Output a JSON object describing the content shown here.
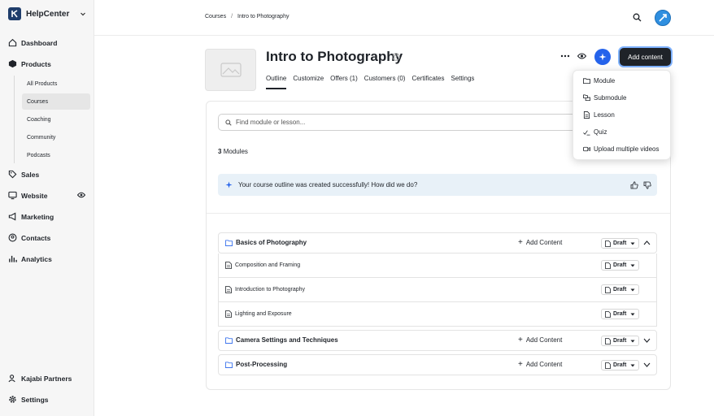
{
  "colors": {
    "brand": "#1f3d6b",
    "accent_blue": "#2563eb",
    "dark_button": "#1f2329",
    "banner_bg": "#e8f1f8"
  },
  "sidebar": {
    "brand": "HelpCenter",
    "items": {
      "dashboard": "Dashboard",
      "products": "Products",
      "sales": "Sales",
      "website": "Website",
      "marketing": "Marketing",
      "contacts": "Contacts",
      "analytics": "Analytics",
      "partners": "Kajabi Partners",
      "settings": "Settings"
    },
    "products_sub": {
      "all_products": "All Products",
      "courses": "Courses",
      "coaching": "Coaching",
      "community": "Community",
      "podcasts": "Podcasts"
    }
  },
  "breadcrumb": {
    "parent": "Courses",
    "separator": "/",
    "current": "Intro to Photography"
  },
  "header": {
    "title": "Intro to Photography",
    "add_button": "Add content",
    "tabs": {
      "outline": "Outline",
      "customize": "Customize",
      "offers": "Offers (1)",
      "customers": "Customers (0)",
      "certificates": "Certificates",
      "settings": "Settings"
    }
  },
  "menu": {
    "module": "Module",
    "submodule": "Submodule",
    "lesson": "Lesson",
    "quiz": "Quiz",
    "upload": "Upload multiple videos"
  },
  "outline": {
    "search_placeholder": "Find module or lesson...",
    "count": "3",
    "count_label": "Modules",
    "banner": "Your course outline was created successfully! How did we do?",
    "add_content": "Add Content",
    "draft": "Draft",
    "modules": {
      "m1": "Basics of Photography",
      "m2": "Camera Settings and Techniques",
      "m3": "Post-Processing"
    },
    "lessons": {
      "l1": "Composition and Framing",
      "l2": "Introduction to Photography",
      "l3": "Lighting and Exposure"
    }
  }
}
